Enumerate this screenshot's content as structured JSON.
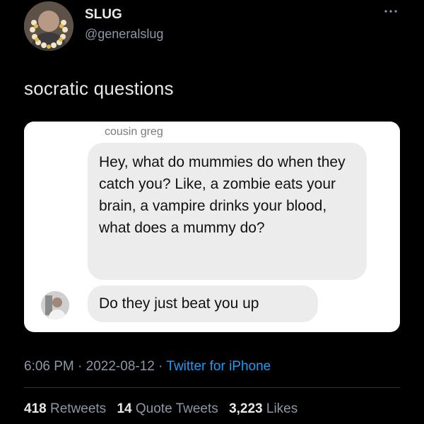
{
  "author": {
    "display_name": "SLUG",
    "handle": "@generalslug"
  },
  "tweet": {
    "text": "socratic questions"
  },
  "embedded_chat": {
    "sender_name": "cousin greg",
    "messages": [
      "Hey, what do mummies do when they catch you? Like, a zombie eats your brain, a vampire drinks your blood, what does a mummy do?",
      "Do they just beat you up"
    ]
  },
  "meta": {
    "time": "6:06 PM",
    "date": "2022-08-12",
    "separator": "·",
    "source": "Twitter for iPhone"
  },
  "stats": {
    "retweets_count": "418",
    "retweets_label": "Retweets",
    "quotes_count": "14",
    "quotes_label": "Quote Tweets",
    "likes_count": "3,223",
    "likes_label": "Likes"
  },
  "colors": {
    "background": "#000000",
    "text_primary": "#e7e9ea",
    "text_secondary": "#8b98a5",
    "link": "#1d9bf0",
    "card_bg": "#ffffff",
    "bubble_bg": "#ececec"
  }
}
